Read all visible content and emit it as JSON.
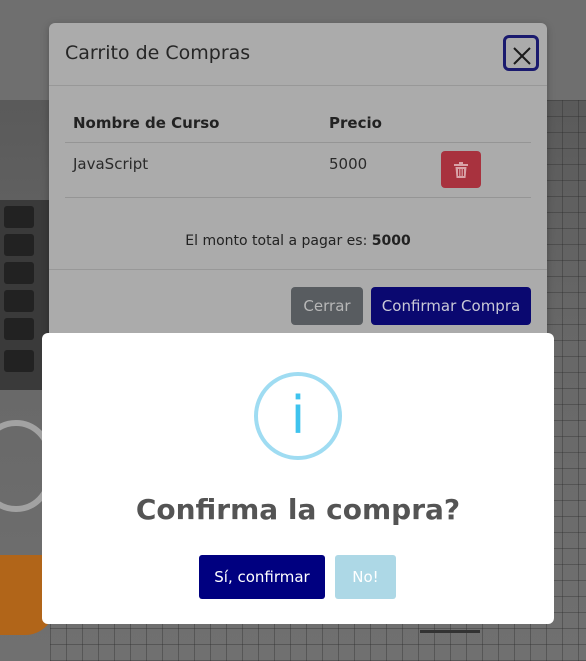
{
  "cart_modal": {
    "title": "Carrito de Compras",
    "table": {
      "headers": [
        "Nombre de Curso",
        "Precio"
      ],
      "rows": [
        {
          "name": "JavaScript",
          "price": "5000"
        }
      ]
    },
    "total_label": "El monto total a pagar es:",
    "total_value": "5000",
    "buttons": {
      "close": "Cerrar",
      "confirm": "Confirmar Compra"
    }
  },
  "confirm_dialog": {
    "icon": "info-icon",
    "icon_glyph": "i",
    "title": "Confirma la compra?",
    "buttons": {
      "yes": "Sí, confirmar",
      "no": "No!"
    }
  },
  "colors": {
    "confirm_yes_bg": "#000080",
    "confirm_no_bg": "#add8e6",
    "info_icon": "#3fc3ee",
    "delete_button": "#dc3545",
    "cart_confirm_button": "#0d0a8c"
  }
}
